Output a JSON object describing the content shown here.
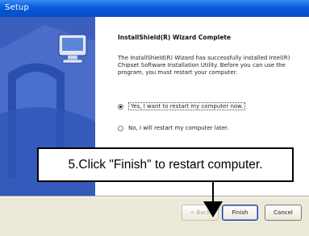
{
  "window": {
    "title": "Setup"
  },
  "wizard": {
    "heading": "InstallShield(R) Wizard Complete",
    "body": "The InstallShield(R) Wizard has successfully installed Intel(R) Chipset Software Installation Utility. Before you can use the program, you must restart your computer.",
    "options": [
      {
        "label": "Yes, I want to restart my computer now.",
        "selected": true
      },
      {
        "label": "No, I will restart my computer later.",
        "selected": false
      }
    ]
  },
  "buttons": {
    "back": "< Back",
    "finish": "Finish",
    "cancel": "Cancel"
  },
  "annotation": {
    "text": "5.Click \"Finish\" to restart computer."
  },
  "colors": {
    "titlebar": "#0a5fdc",
    "side_panel": "#3f63c2",
    "dialog_face": "#ece9d8"
  },
  "icons": {
    "side_panel_icon": "computer-icon"
  }
}
